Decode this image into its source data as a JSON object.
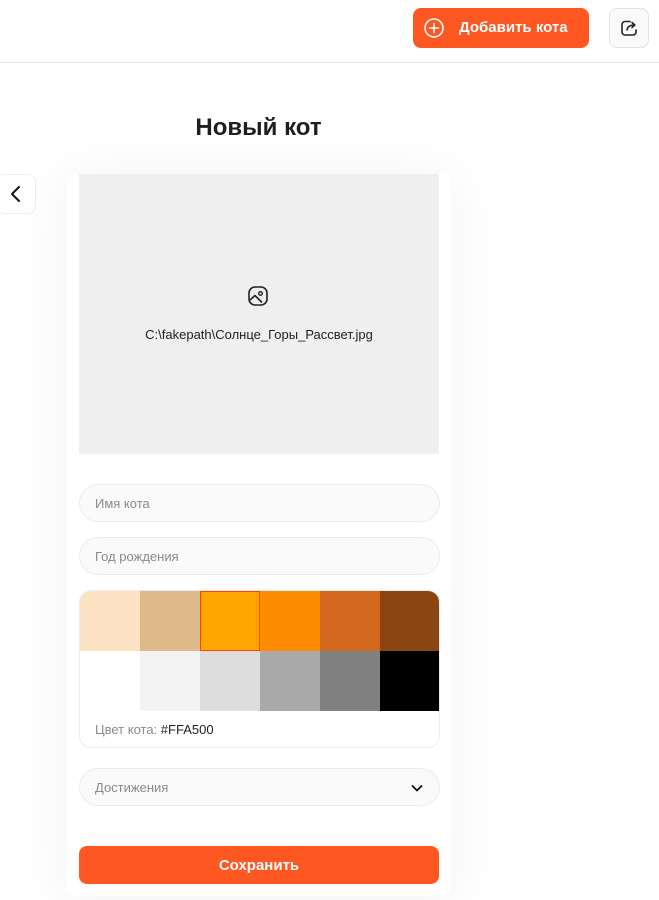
{
  "header": {
    "add_cat_label": "Добавить кота",
    "add_icon": "plus-circle-icon",
    "share_icon": "share-icon",
    "accent_color": "#FF5722"
  },
  "page": {
    "title": "Новый кот",
    "back_icon": "chevron-left-icon"
  },
  "form": {
    "photo": {
      "icon": "image-icon",
      "filename": "C:\\fakepath\\Солнце_Горы_Рассвет.jpg"
    },
    "name_placeholder": "Имя кота",
    "birth_year_placeholder": "Год рождения",
    "colors": [
      "#FDE3C4",
      "#DEB98A",
      "#FFA500",
      "#FF8C00",
      "#D2691E",
      "#8B4513",
      "#FFFFFF",
      "#F3F3F3",
      "#DDDDDD",
      "#A9A9A9",
      "#808080",
      "#000000"
    ],
    "selected_color_index": 2,
    "color_label": "Цвет кота:",
    "color_value": "#FFA500",
    "achievements_placeholder": "Достижения",
    "achievements_icon": "chevron-down-icon",
    "save_label": "Сохранить"
  }
}
